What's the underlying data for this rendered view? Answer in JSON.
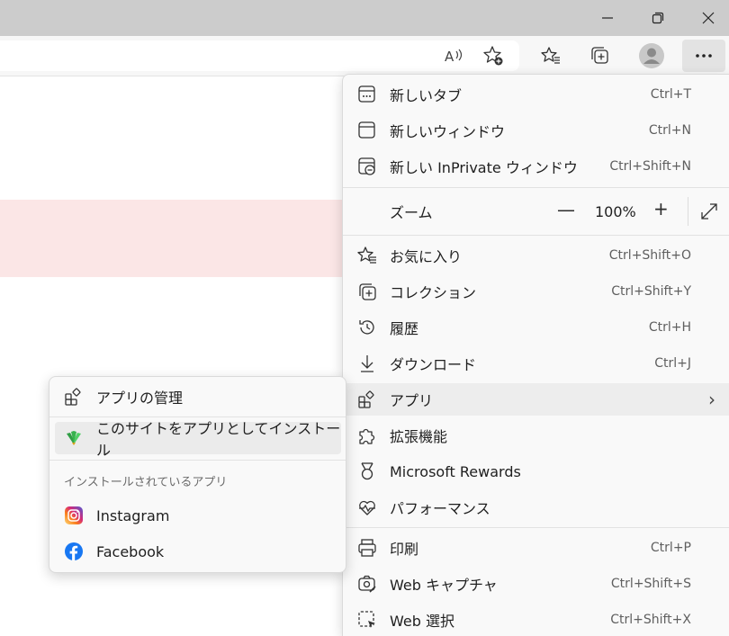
{
  "window": {
    "minimize_icon": "minimize-icon",
    "restore_icon": "restore-icon",
    "close_icon": "close-icon"
  },
  "toolbar": {
    "read_aloud_icon": "read-aloud-icon",
    "add_favorite_icon": "add-favorite-icon",
    "favorites_icon": "favorites-icon",
    "collections_icon": "collections-icon",
    "profile_icon": "profile-avatar-icon",
    "more_icon": "more-dots-icon"
  },
  "menu": {
    "new_tab": {
      "label": "新しいタブ",
      "shortcut": "Ctrl+T"
    },
    "new_window": {
      "label": "新しいウィンドウ",
      "shortcut": "Ctrl+N"
    },
    "new_inprivate": {
      "label": "新しい InPrivate ウィンドウ",
      "shortcut": "Ctrl+Shift+N"
    },
    "zoom": {
      "label": "ズーム",
      "minus": "—",
      "value": "100%",
      "plus": "+"
    },
    "favorites": {
      "label": "お気に入り",
      "shortcut": "Ctrl+Shift+O"
    },
    "collections": {
      "label": "コレクション",
      "shortcut": "Ctrl+Shift+Y"
    },
    "history": {
      "label": "履歴",
      "shortcut": "Ctrl+H"
    },
    "downloads": {
      "label": "ダウンロード",
      "shortcut": "Ctrl+J"
    },
    "apps": {
      "label": "アプリ",
      "chevron": "›"
    },
    "extensions": {
      "label": "拡張機能"
    },
    "rewards": {
      "label": "Microsoft Rewards"
    },
    "performance": {
      "label": "パフォーマンス"
    },
    "print": {
      "label": "印刷",
      "shortcut": "Ctrl+P"
    },
    "web_capture": {
      "label": "Web キャプチャ",
      "shortcut": "Ctrl+Shift+S"
    },
    "web_select": {
      "label": "Web 選択",
      "shortcut": "Ctrl+Shift+X"
    }
  },
  "apps_submenu": {
    "manage": "アプリの管理",
    "install_site": "このサイトをアプリとしてインストール",
    "installed_header": "インストールされているアプリ",
    "installed": [
      {
        "label": "Instagram",
        "icon": "instagram-icon"
      },
      {
        "label": "Facebook",
        "icon": "facebook-icon"
      }
    ]
  },
  "colors": {
    "titlebar": "#cccccc",
    "menu_bg": "#f9f9f9",
    "highlight": "#ededed",
    "facebook": "#1877f2",
    "content_band": "#fbe6e6"
  }
}
